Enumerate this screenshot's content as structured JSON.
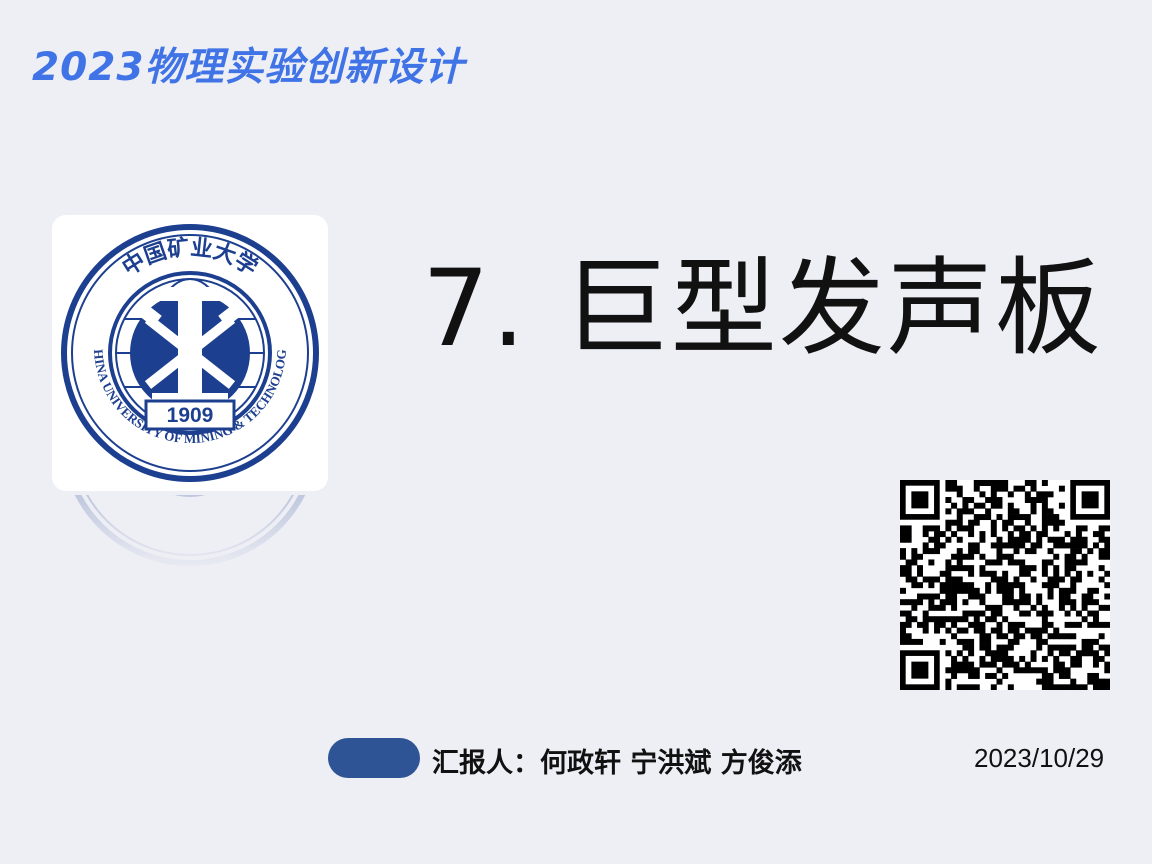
{
  "slide": {
    "course_title": "2023物理实验创新设计",
    "main_title": "7. 巨型发声板",
    "presenter": "汇报人：何政轩 宁洪斌  方俊添",
    "date": "2023/10/29"
  },
  "logo": {
    "top_text": "中国矿业大学",
    "ring_text": "CHINA UNIVERSITY OF MINING & TECHNOLOGY",
    "year": "1909",
    "ring_color": "#1d3f8f"
  },
  "colors": {
    "background": "#eeeff5",
    "course_title": "#3f73e6",
    "pill": "#2f5496"
  },
  "icons": {
    "logo": "university-emblem-icon",
    "qr": "qr-code-icon"
  }
}
